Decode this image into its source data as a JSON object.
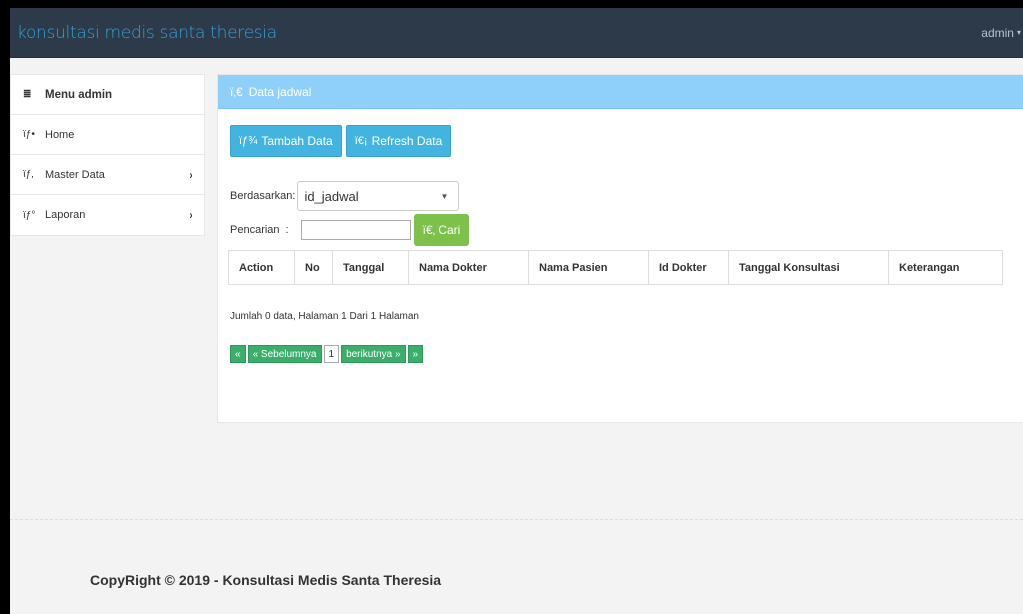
{
  "app": {
    "title": "konsultasi medis santa theresia",
    "user": "admin"
  },
  "sidebar": {
    "items": [
      {
        "label": "Menu admin",
        "icon": "≣",
        "arrow": ""
      },
      {
        "label": "Home",
        "icon": "ïƒ•",
        "arrow": ""
      },
      {
        "label": "Master Data",
        "icon": "ïƒ‚",
        "arrow": "›"
      },
      {
        "label": "Laporan",
        "icon": "ïƒ°",
        "arrow": "›"
      }
    ]
  },
  "panel": {
    "heading_icon": "ï‚€",
    "heading": "Data jadwal",
    "add_icon": "ïƒ¾",
    "add_label": "Tambah Data",
    "refresh_icon": "ï€¡",
    "refresh_label": "Refresh Data",
    "filter_label": "Berdasarkan",
    "filter_value": "id_jadwal",
    "search_label": "Pencarian",
    "search_value": "",
    "search_button_icon": "ï€‚",
    "search_button": "Cari",
    "table_headers": [
      "Action",
      "No",
      "Tanggal",
      "Nama Dokter",
      "Nama Pasien",
      "Id Dokter",
      "Tanggal Konsultasi",
      "Keterangan"
    ],
    "summary": "Jumlah 0 data, Halaman 1 Dari 1 Halaman",
    "pager": {
      "first": "«",
      "prev": "« Sebelumnya",
      "page": "1",
      "next": "berikutnya »",
      "last": "»"
    }
  },
  "footer": "CopyRight © 2019 - Konsultasi Medis Santa Theresia"
}
